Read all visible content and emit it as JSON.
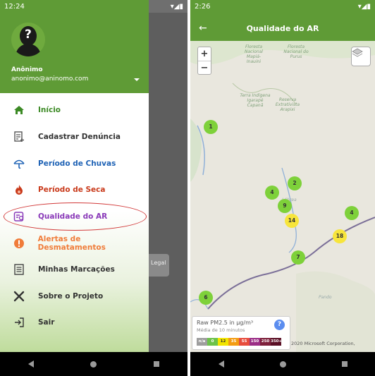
{
  "left_phone": {
    "status": {
      "time": "12:24"
    },
    "drawer": {
      "user_name": "Anônimo",
      "user_email": "anonimo@aninomo.com",
      "items": [
        {
          "label": "Início",
          "icon": "home-icon",
          "color": "#3c8a25"
        },
        {
          "label": "Cadastrar Denúncia",
          "icon": "report-add-icon",
          "color": "#333333"
        },
        {
          "label": "Período de Chuvas",
          "icon": "umbrella-icon",
          "color": "#1e62b5"
        },
        {
          "label": "Período de Seca",
          "icon": "fire-icon",
          "color": "#c93a1b"
        },
        {
          "label": "Qualidade do AR",
          "icon": "air-quality-icon",
          "color": "#8a3ab9"
        },
        {
          "label": "Alertas de Desmatamentos",
          "icon": "alert-icon",
          "color": "#f07c3a"
        },
        {
          "label": "Minhas Marcações",
          "icon": "list-icon",
          "color": "#333333"
        },
        {
          "label": "Sobre o Projeto",
          "icon": "tools-icon",
          "color": "#333333"
        },
        {
          "label": "Sair",
          "icon": "logout-icon",
          "color": "#333333"
        }
      ]
    },
    "background_card": "Legal"
  },
  "right_phone": {
    "status": {
      "time": "2:26"
    },
    "title": "Qualidade do AR",
    "map": {
      "zoom_in": "+",
      "zoom_out": "−",
      "places": [
        {
          "text": "Floresta Nacional Mapiá-Inauini"
        },
        {
          "text": "Floresta Nacional do Purus"
        },
        {
          "text": "Terra Indígena Igarapé Capanã"
        },
        {
          "text": "Reserva Extrativista Arapixi"
        }
      ],
      "towns": [
        "Lábrea",
        "Pando"
      ],
      "markers": [
        {
          "value": "1",
          "level": "good"
        },
        {
          "value": "2",
          "level": "good"
        },
        {
          "value": "4",
          "level": "good"
        },
        {
          "value": "9",
          "level": "good"
        },
        {
          "value": "4",
          "level": "good"
        },
        {
          "value": "14",
          "level": "moderate"
        },
        {
          "value": "18",
          "level": "moderate"
        },
        {
          "value": "7",
          "level": "good"
        },
        {
          "value": "6",
          "level": "good"
        }
      ],
      "legend": {
        "title": "Raw PM2.5 in µg/m³",
        "subtitle": "Média de 10 minutos",
        "help": "?",
        "scale": [
          {
            "label": "n/a",
            "color": "#9e9e9e"
          },
          {
            "label": "0",
            "color": "#6cc24a"
          },
          {
            "label": "12",
            "color": "#f2e500"
          },
          {
            "label": "35",
            "color": "#f39c12"
          },
          {
            "label": "55",
            "color": "#e74c3c"
          },
          {
            "label": "150",
            "color": "#9b2d86"
          },
          {
            "label": "250",
            "color": "#7d1f3a"
          },
          {
            "label": "350+",
            "color": "#5a0f25"
          }
        ]
      },
      "copyright": "2020 Microsoft Corporation,"
    }
  },
  "colors": {
    "primary": "#5f9b36",
    "marker_good": "#7ed13a",
    "marker_moderate": "#f7e53b"
  }
}
